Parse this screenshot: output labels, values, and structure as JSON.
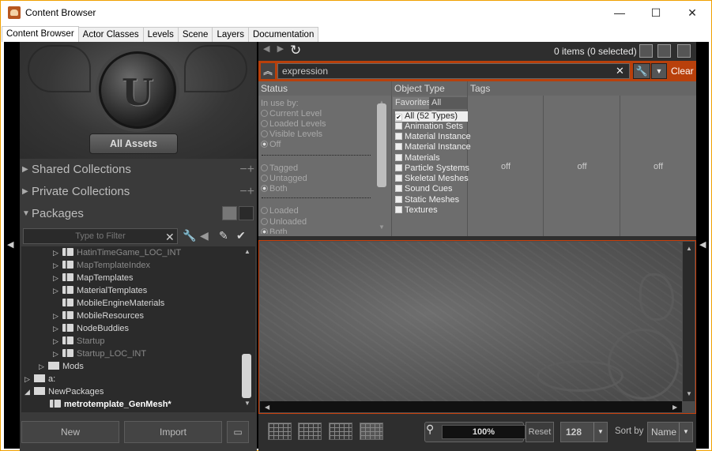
{
  "window": {
    "title": "Content Browser",
    "minimize": "—",
    "maximize": "☐",
    "close": "✕"
  },
  "tabs": [
    "Content Browser",
    "Actor Classes",
    "Levels",
    "Scene",
    "Layers",
    "Documentation"
  ],
  "left_panel": {
    "all_assets": "All Assets",
    "sections": [
      {
        "label": "Shared Collections",
        "arrow": "▶",
        "actions": "−+"
      },
      {
        "label": "Private Collections",
        "arrow": "▶",
        "actions": "−+"
      },
      {
        "label": "Packages",
        "arrow": "▼",
        "actions": ""
      }
    ],
    "filter_placeholder": "Type to Filter",
    "tree": [
      {
        "label": "HatinTimeGame_LOC_INT",
        "icon": "package",
        "expand": "▷",
        "dim": true
      },
      {
        "label": "MapTemplateIndex",
        "icon": "package",
        "expand": "▷",
        "dim": true
      },
      {
        "label": "MapTemplates",
        "icon": "package",
        "expand": "▷",
        "dim": false
      },
      {
        "label": "MaterialTemplates",
        "icon": "package",
        "expand": "▷",
        "dim": false
      },
      {
        "label": "MobileEngineMaterials",
        "icon": "package",
        "expand": "",
        "dim": false
      },
      {
        "label": "MobileResources",
        "icon": "package",
        "expand": "▷",
        "dim": false
      },
      {
        "label": "NodeBuddies",
        "icon": "package",
        "expand": "▷",
        "dim": false
      },
      {
        "label": "Startup",
        "icon": "package",
        "expand": "▷",
        "dim": true
      },
      {
        "label": "Startup_LOC_INT",
        "icon": "package",
        "expand": "▷",
        "dim": true
      },
      {
        "label": "Mods",
        "icon": "folder",
        "expand": "▷",
        "dim": false
      },
      {
        "label": "a:",
        "icon": "folder",
        "expand": "▷",
        "dim": false
      },
      {
        "label": "NewPackages",
        "icon": "folder",
        "expand": "◢",
        "dim": false
      },
      {
        "label": "metrotemplate_GenMesh*",
        "icon": "package",
        "expand": "",
        "dim": false,
        "bold": true
      }
    ],
    "buttons": {
      "new": "New",
      "import": "Import"
    }
  },
  "right_panel": {
    "items_count": "0 items (0 selected)",
    "search_value": "expression",
    "clear_label": "Clear",
    "filter_headers": {
      "status": "Status",
      "object_type": "Object Type",
      "tags": "Tags"
    },
    "status_lines": [
      {
        "text": "In use by:",
        "radio": "none"
      },
      {
        "text": "Current Level",
        "radio": "off"
      },
      {
        "text": "Loaded Levels",
        "radio": "off"
      },
      {
        "text": "Visible Levels",
        "radio": "off"
      },
      {
        "text": "Off",
        "radio": "on"
      },
      {
        "text": "Tagged",
        "radio": "off"
      },
      {
        "text": "Untagged",
        "radio": "off"
      },
      {
        "text": "Both",
        "radio": "on"
      },
      {
        "text": "Loaded",
        "radio": "off"
      },
      {
        "text": "Unloaded",
        "radio": "off"
      },
      {
        "text": "Both",
        "radio": "on"
      }
    ],
    "object_type_tabs": {
      "favorites": "Favorites",
      "all_types": "All Types"
    },
    "object_types": [
      {
        "label": "All (52 Types)",
        "checked": true
      },
      {
        "label": "Animation Sets",
        "checked": false
      },
      {
        "label": "Material Instance",
        "checked": false
      },
      {
        "label": "Material Instance",
        "checked": false
      },
      {
        "label": "Materials",
        "checked": false
      },
      {
        "label": "Particle Systems",
        "checked": false
      },
      {
        "label": "Skeletal Meshes",
        "checked": false
      },
      {
        "label": "Sound Cues",
        "checked": false
      },
      {
        "label": "Static Meshes",
        "checked": false
      },
      {
        "label": "Textures",
        "checked": false
      }
    ],
    "tag_columns": [
      "off",
      "off",
      "off"
    ],
    "zoom": "100%",
    "reset": "Reset",
    "thumb_size": "128",
    "sort_by_label": "Sort by",
    "sort_value": "Name"
  },
  "colors": {
    "accent": "#b9400b",
    "frame": "#f0a000",
    "panel": "#3a3a3a"
  }
}
